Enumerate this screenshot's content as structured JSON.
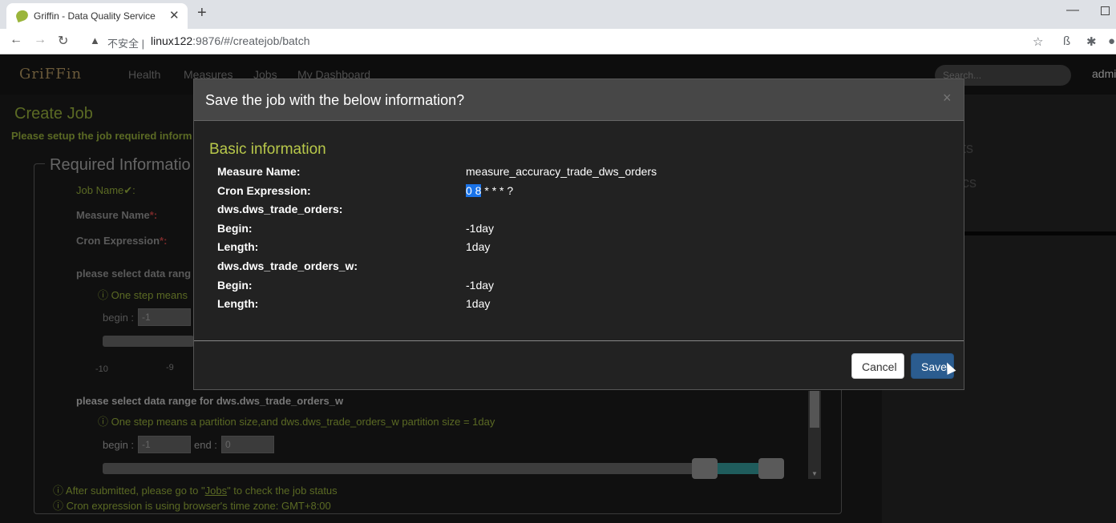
{
  "browser": {
    "tab_title": "Griffin - Data Quality Service",
    "tab_close": "✕",
    "new_tab": "+",
    "insecure_label": "不安全",
    "url_host": "linux122",
    "url_path": ":9876/#/createjob/batch"
  },
  "appnav": {
    "logo": "GriFFin",
    "links": [
      "Health",
      "Measures",
      "Jobs",
      "My Dashboard"
    ],
    "search_placeholder": "Search...",
    "user": "admi"
  },
  "page": {
    "title": "Create Job",
    "subtitle": "Please setup the job required inform",
    "legend": "Required Informatio",
    "job_name_label": "Job Name✔:",
    "measure_name_label": "Measure Name",
    "cron_label": "Cron Expression",
    "required_mark": "*:",
    "range1_label": "please select data rang",
    "range1_note": "ⓘ One step means",
    "begin_label": "begin :",
    "begin1_value": "-1",
    "tick_a": "-10",
    "tick_b": "-9",
    "range2_label": "please select data range for dws.dws_trade_orders_w",
    "range2_note": "ⓘ One step means a partition size,and dws.dws_trade_orders_w partition size = 1day",
    "begin2_value": "-1",
    "end_label": "end :",
    "end2_value": "0",
    "footnote1_pre": "ⓘ After submitted, please go to \"",
    "footnote1_link": "Jobs",
    "footnote1_post": "\" to check the job status",
    "footnote2": "ⓘ Cron expression is using browser's time zone: GMT+8:00",
    "right_label_1": "ts",
    "right_label_2": "ics"
  },
  "modal": {
    "title": "Save the job with the below information?",
    "close": "×",
    "section_title": "Basic information",
    "rows": [
      {
        "key": "Measure Name:",
        "value": "measure_accuracy_trade_dws_orders"
      },
      {
        "key": "Cron Expression:",
        "value_selected": "0 8",
        "value_rest": " * * * ?"
      },
      {
        "key": "dws.dws_trade_orders:",
        "value": ""
      },
      {
        "key": "Begin:",
        "value": "-1day"
      },
      {
        "key": "Length:",
        "value": "1day"
      },
      {
        "key": "dws.dws_trade_orders_w:",
        "value": ""
      },
      {
        "key": "Begin:",
        "value": "-1day"
      },
      {
        "key": "Length:",
        "value": "1day"
      }
    ],
    "cancel_label": "Cancel",
    "save_label": "Save"
  }
}
